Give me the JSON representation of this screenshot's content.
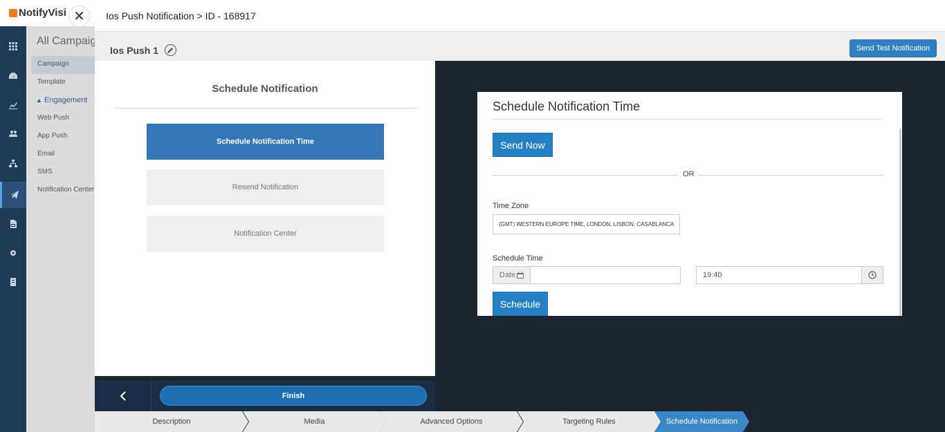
{
  "app": {
    "brand": "NotifyVisi",
    "section_title": "All Campaign",
    "sub_menu": [
      {
        "label": "Campaign",
        "active": true
      },
      {
        "label": "Template"
      },
      {
        "label": "Engagement",
        "group": true
      },
      {
        "label": "Web Push"
      },
      {
        "label": "App Push"
      },
      {
        "label": "Email"
      },
      {
        "label": "SMS"
      },
      {
        "label": "Notification Center"
      }
    ],
    "sidebar_icons": [
      "grid-icon",
      "dashboard-icon",
      "chart-icon",
      "users-icon",
      "sitemap-icon",
      "send-icon",
      "report-icon",
      "settings-icon",
      "billing-icon"
    ]
  },
  "modal": {
    "title": "Ios Push Notification > ID - 168917",
    "close_glyph": "✕",
    "campaign_name": "Ios Push 1",
    "test_button": "Send Test Notification",
    "left_panel": {
      "title": "Schedule Notification",
      "options": [
        "Schedule Notification Time",
        "Resend Notification",
        "Notification Center"
      ]
    },
    "footer": {
      "finish": "Finish"
    },
    "card": {
      "title": "Schedule Notification Time",
      "send_now": "Send Now",
      "or": "OR",
      "timezone_label": "Time Zone",
      "timezone_value": "(GMT) WESTERN EUROPE TIME, LONDON, LISBON, CASABLANCA",
      "schedule_label": "Schedule Time",
      "date_addon": "Date",
      "date_value": "",
      "time_value": "19:40",
      "schedule_button": "Schedule"
    },
    "steps": [
      "Description",
      "Media",
      "Advanced Options",
      "Targeting Rules",
      "Schedule Notification"
    ],
    "active_step": "Schedule Notification"
  },
  "colors": {
    "primary": "#3578b8",
    "button_blue": "#2581c4",
    "sidebar": "#1d3a57",
    "modal_dark": "#1b2530"
  }
}
